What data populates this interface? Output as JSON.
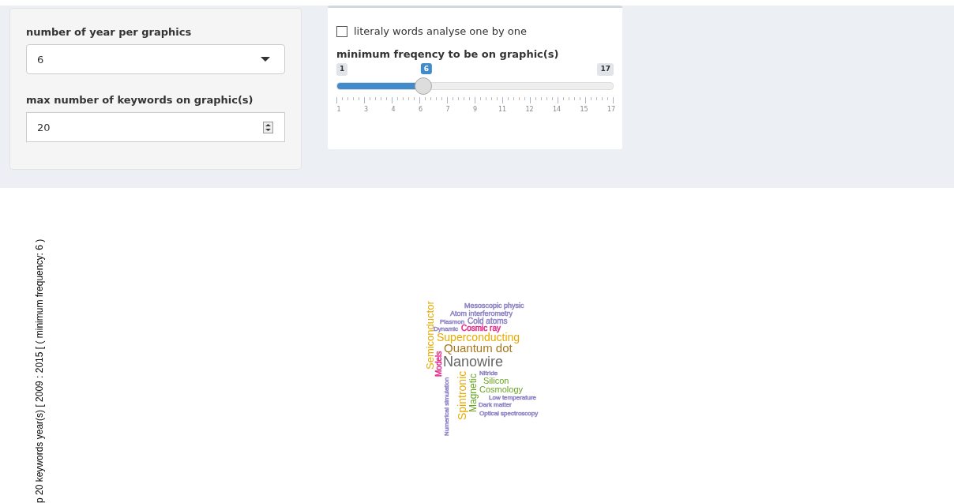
{
  "year_select": {
    "label": "number of year per graphics",
    "value": "6"
  },
  "keywords_input": {
    "label": "max number of keywords on graphic(s)",
    "value": "20"
  },
  "literal_checkbox": {
    "label": "literaly words analyse one by one",
    "checked": false
  },
  "frequency_slider": {
    "label": "minimum freqency to be on graphic(s)",
    "min": "1",
    "max": "17",
    "value": "6",
    "level": 0.3125,
    "ticks": [
      "1",
      "3",
      "4",
      "6",
      "7",
      "9",
      "11",
      "12",
      "14",
      "15",
      "17"
    ]
  },
  "plot_title": "p 20 keywords  year(s) [ 2009 : 2015 [ ( minimum frequency: 6 )",
  "word_cloud": [
    {
      "text": "Mesoscopic physic",
      "color": "#8d82c4"
    },
    {
      "text": "Atom interferometry",
      "color": "#8d82c4"
    },
    {
      "text": "Plasmon",
      "color": "#8d82c4"
    },
    {
      "text": "Cold atoms",
      "color": "#8d82c4"
    },
    {
      "text": "Dynamic",
      "color": "#8d82c4"
    },
    {
      "text": "Cosmic ray",
      "color": "#e7298a"
    },
    {
      "text": "Superconducting",
      "color": "#e6ab02"
    },
    {
      "text": "Quantum dot",
      "color": "#a6761d"
    },
    {
      "text": "Nanowire",
      "color": "#666666"
    },
    {
      "text": "Semiconductor",
      "color": "#e6ab02"
    },
    {
      "text": "Models",
      "color": "#e7298a"
    },
    {
      "text": "Numerical simulation",
      "color": "#8d82c4"
    },
    {
      "text": "Spintronic",
      "color": "#e6ab02"
    },
    {
      "text": "Magnetic",
      "color": "#66a61e"
    },
    {
      "text": "Nitride",
      "color": "#8d82c4"
    },
    {
      "text": "Silicon",
      "color": "#66a61e"
    },
    {
      "text": "Cosmology",
      "color": "#66a61e"
    },
    {
      "text": "Low temperature",
      "color": "#8d82c4"
    },
    {
      "text": "Dark matter",
      "color": "#8d82c4"
    },
    {
      "text": "Optical spectroscopy",
      "color": "#8d82c4"
    }
  ]
}
